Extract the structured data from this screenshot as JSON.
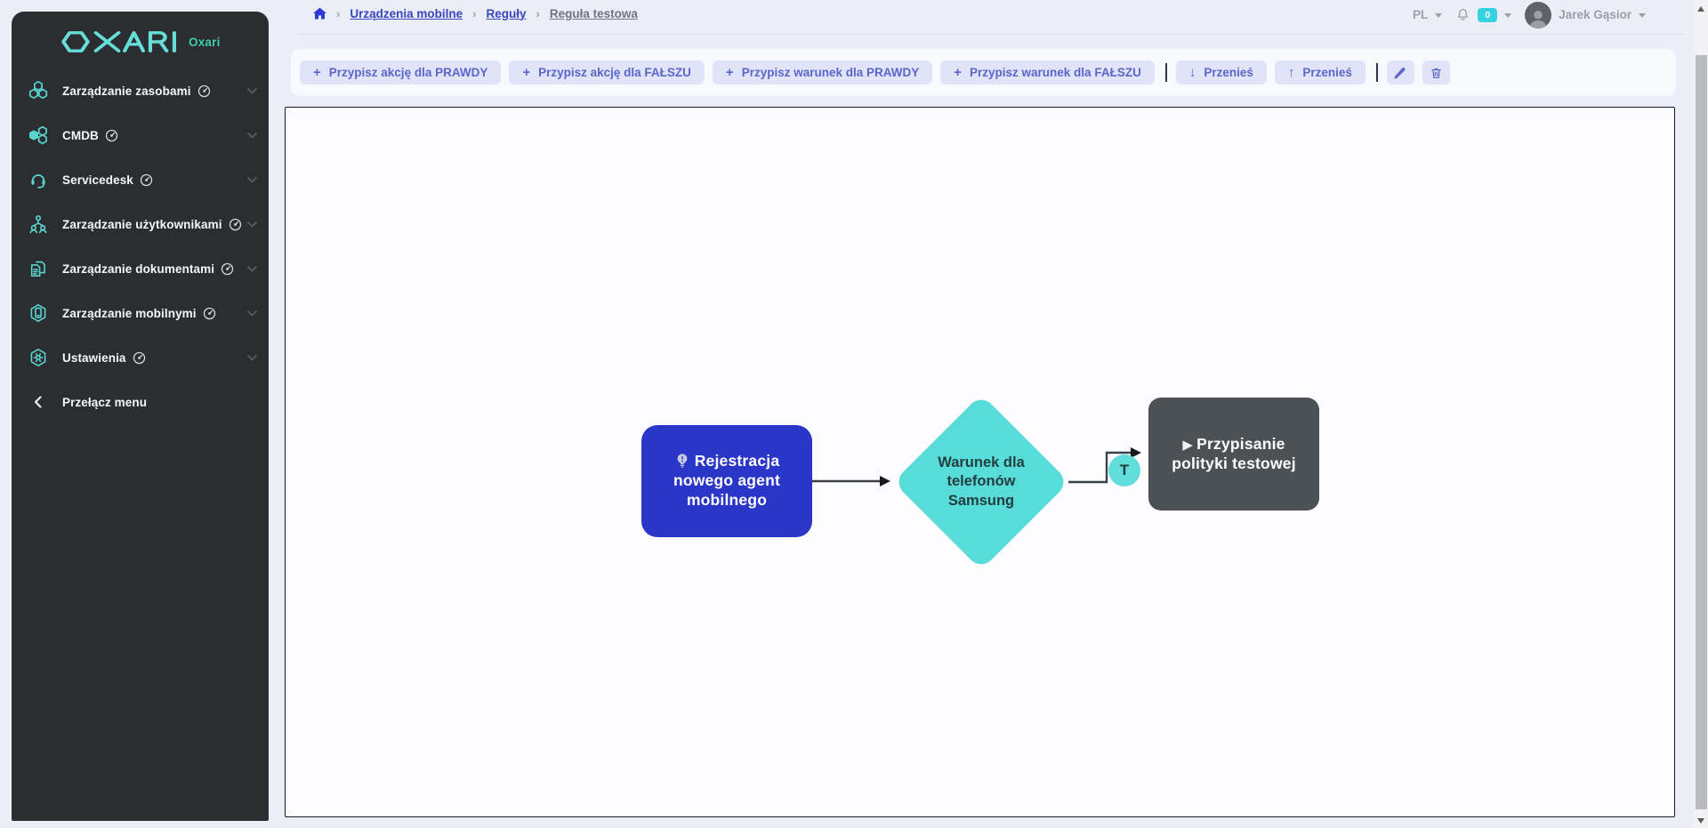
{
  "app": {
    "logo_text": "OXARI",
    "logo_subtext": "Oxari"
  },
  "sidebar": {
    "items": [
      {
        "label": "Zarządzanie zasobami",
        "icon": "hexagon-cluster-icon"
      },
      {
        "label": "CMDB",
        "icon": "cmdb-nodes-icon"
      },
      {
        "label": "Servicedesk",
        "icon": "headset-icon"
      },
      {
        "label": "Zarządzanie użytkownikami",
        "icon": "users-org-icon"
      },
      {
        "label": "Zarządzanie dokumentami",
        "icon": "documents-icon"
      },
      {
        "label": "Zarządzanie mobilnymi",
        "icon": "mobile-device-icon"
      },
      {
        "label": "Ustawienia",
        "icon": "settings-gear-icon"
      }
    ],
    "toggle_label": "Przełącz menu"
  },
  "header": {
    "breadcrumb": {
      "separator": "›",
      "items": [
        "Urządzenia mobilne",
        "Reguły",
        "Reguła testowa"
      ]
    },
    "language": "PL",
    "notifications_count": "0",
    "user_name": "Jarek Gąsior"
  },
  "toolbar": {
    "icons": {
      "plus": "+",
      "arrow_down": "↓",
      "arrow_up": "↑"
    },
    "buttons": [
      {
        "label": "Przypisz akcję dla PRAWDY"
      },
      {
        "label": "Przypisz akcję dla FAŁSZU"
      },
      {
        "label": "Przypisz warunek dla PRAWDY"
      },
      {
        "label": "Przypisz warunek dla FAŁSZU"
      }
    ],
    "move_down_label": "Przenieś",
    "move_up_label": "Przenieś"
  },
  "flowchart": {
    "icons": {
      "play": "▶"
    },
    "trigger_node": {
      "label": "Rejestracja nowego agent mobilnego",
      "color": "#2a36c8"
    },
    "condition_node": {
      "label": "Warunek dla telefonów Samsung",
      "color": "#58dcda"
    },
    "action_node": {
      "label": "Przypisanie polityki testowej",
      "color": "#4c5156"
    },
    "true_edge_label": "T"
  },
  "colors": {
    "accent_teal": "#59d6d1",
    "page_bg": "#ebedf7",
    "sidebar_bg": "#2b2d30",
    "button_bg": "#e1e4f8",
    "button_fg": "#5a66c9",
    "notification_badge": "#35d3e2",
    "edge": "#3c4147"
  }
}
